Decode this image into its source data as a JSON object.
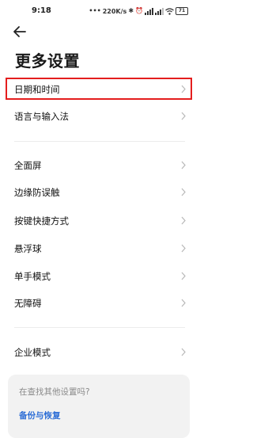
{
  "status_bar": {
    "time": "9:18",
    "net_speed": "220K/s",
    "battery": "71",
    "icons": [
      "bluetooth-icon",
      "alarm-icon",
      "signal-icon",
      "signal-icon",
      "wifi-icon",
      "battery-icon"
    ]
  },
  "header": {
    "back_icon": "arrow-left-icon",
    "title": "更多设置"
  },
  "settings": {
    "items": [
      {
        "label": "日期和时间"
      },
      {
        "label": "语言与输入法"
      },
      {
        "label": "全面屏"
      },
      {
        "label": "边缘防误触"
      },
      {
        "label": "按键快捷方式"
      },
      {
        "label": "悬浮球"
      },
      {
        "label": "单手模式"
      },
      {
        "label": "无障碍"
      },
      {
        "label": "企业模式"
      }
    ],
    "chevron_icon": "chevron-right-icon",
    "highlighted_index": 0
  },
  "suggestion": {
    "question": "在查找其他设置吗?",
    "link": "备份与恢复"
  },
  "colors": {
    "highlight_border": "#e41e1e",
    "link": "#2f6fd6",
    "card_bg": "#f2f2f2"
  }
}
